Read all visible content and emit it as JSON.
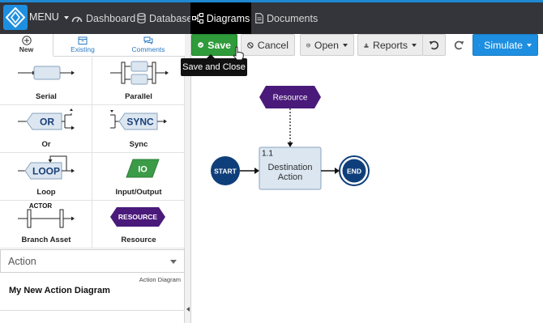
{
  "topbar": {
    "menu_label": "MENU",
    "nav": {
      "dashboard": "Dashboard",
      "database": "Database",
      "diagrams": "Diagrams",
      "documents": "Documents"
    },
    "accent_color": "#1e88d2",
    "active_color": "#000000"
  },
  "left_panel": {
    "tabs": {
      "new": "New",
      "existing": "Existing",
      "comments": "Comments"
    },
    "shapes": {
      "serial": "Serial",
      "parallel": "Parallel",
      "or": "Or",
      "or_text": "OR",
      "sync": "Sync",
      "sync_text": "SYNC",
      "loop": "Loop",
      "loop_text": "LOOP",
      "io": "Input/Output",
      "io_text": "IO",
      "branch_asset": "Branch Asset",
      "actor_text": "ACTOR",
      "resource": "Resource",
      "resource_text": "RESOURCE"
    },
    "diagram_type_select": "Action",
    "diagram_type_label": "Action Diagram",
    "diagram_name": "My New Action Diagram"
  },
  "toolbar": {
    "save": "Save",
    "cancel": "Cancel",
    "open": "Open",
    "reports": "Reports",
    "simulate": "Simulate",
    "save_color": "#2f9b3b",
    "simulate_color": "#1e8fe0"
  },
  "tooltip": "Save and Close",
  "canvas": {
    "resource_label": "Resource",
    "start_label": "START",
    "end_label": "END",
    "action_number": "1.1",
    "action_line1": "Destination",
    "action_line2": "Action",
    "resource_color": "#4a1a7a",
    "start_color": "#0f3f7a"
  }
}
